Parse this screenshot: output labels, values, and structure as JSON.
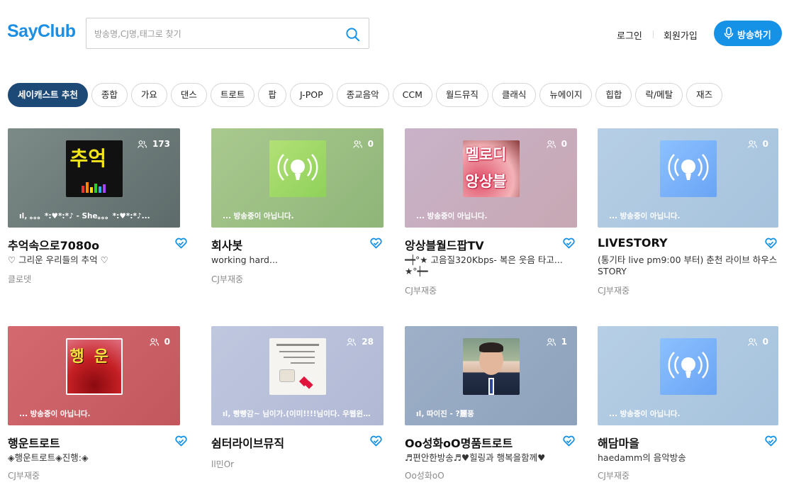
{
  "header": {
    "logo": "SayClub",
    "search_placeholder": "방송명,CJ명,태그로 찾기",
    "login": "로그인",
    "signup": "회원가입",
    "broadcast_button": "방송하기"
  },
  "categories": [
    "세이캐스트 추천",
    "종합",
    "가요",
    "댄스",
    "트로트",
    "팝",
    "J-POP",
    "종교음악",
    "CCM",
    "월드뮤직",
    "클래식",
    "뉴에이지",
    "힙합",
    "락/메탈",
    "재즈"
  ],
  "channels": [
    {
      "title": "추억속으로7080o",
      "desc1": "♡ 그리운 우리들의 추억 ♡",
      "desc2": "",
      "cj": "클로뎃",
      "viewers": "173",
      "status": "ıl‚ 。。。*:♥*:*♪ - She。。。*:♥*:*♪...",
      "art_label": "추억"
    },
    {
      "title": "회사봇",
      "desc1": "working hard...",
      "desc2": "",
      "cj": "CJ부재중",
      "viewers": "0",
      "status": "... 방송중이 아닙니다.",
      "art_label": ""
    },
    {
      "title": "앙상블월드팝TV",
      "desc1": "━┿°★ 고음질320Kbps- 복은 웃음 타고...",
      "desc2": "★°┿━",
      "cj": "CJ부재중",
      "viewers": "0",
      "status": "... 방송중이 아닙니다.",
      "art_label_1": "멜로디",
      "art_label_2": "앙상블"
    },
    {
      "title": "LIVESTORY",
      "desc1": "(통기타 live pm9:00 부터) 춘천 라이브 하우스",
      "desc2": "STORY",
      "cj": "CJ부재중",
      "viewers": "0",
      "status": "... 방송중이 아닙니다.",
      "art_label": ""
    },
    {
      "title": "행운트로트",
      "desc1": "◈행운트로트◈진행:◈",
      "desc2": "",
      "cj": "CJ부재중",
      "viewers": "0",
      "status": "... 방송중이 아닙니다.",
      "art_label": "행운"
    },
    {
      "title": "쉼터라이브뮤직",
      "desc1": "",
      "desc2": "",
      "cj": "ll민Or",
      "viewers": "28",
      "status": "ıl‚ 빵빵감~ 님이가.(이미!!!!님이다. 우웹윈대...",
      "art_label": ""
    },
    {
      "title": "Oo성화oO명품트로트",
      "desc1": "♬편안한방송♬♥힐링과 행복을함께♥",
      "desc2": "",
      "cj": "Oo성화oO",
      "viewers": "1",
      "status": "ıl‚ 따이진 - ?麗풍",
      "art_label": ""
    },
    {
      "title": "해담마을",
      "desc1": "haedamm의 음악방송",
      "desc2": "",
      "cj": "CJ부재중",
      "viewers": "0",
      "status": "... 방송중이 아닙니다.",
      "art_label": ""
    }
  ],
  "colors": {
    "brand": "#1591e6",
    "active_category": "#1c4976",
    "heart": "#1591e6"
  }
}
